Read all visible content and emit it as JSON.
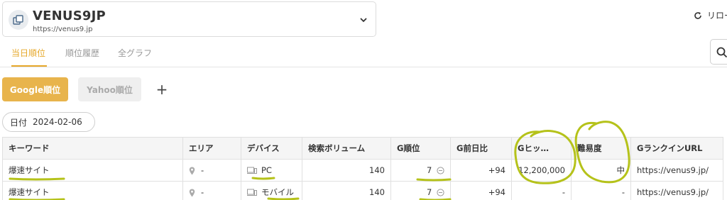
{
  "site": {
    "name": "VENUS9JP",
    "url": "https://venus9.jp"
  },
  "header": {
    "reload_label": "リロー"
  },
  "tabs": [
    {
      "label": "当日順位",
      "active": true
    },
    {
      "label": "順位履歴",
      "active": false
    },
    {
      "label": "全グラフ",
      "active": false
    }
  ],
  "engines": {
    "google_label": "Google順位",
    "yahoo_label": "Yahoo順位",
    "add_label": "+"
  },
  "date": {
    "label": "日付",
    "value": "2024-02-06"
  },
  "table": {
    "headers": [
      "キーワード",
      "エリア",
      "デバイス",
      "検索ボリューム",
      "G順位",
      "G前日比",
      "Gヒッ…",
      "難易度",
      "GランクインURL"
    ],
    "rows": [
      {
        "keyword": "爆速サイト",
        "area": "-",
        "device": "PC",
        "volume": "140",
        "rank": "7",
        "change": "+94",
        "hits": "12,200,000",
        "difficulty": "中",
        "url": "https://venus9.jp/"
      },
      {
        "keyword": "爆速サイト",
        "area": "-",
        "device": "モバイル",
        "volume": "140",
        "rank": "7",
        "change": "+94",
        "hits": "-",
        "difficulty": "-",
        "url": "https://venus9.jp/"
      }
    ]
  },
  "colors": {
    "accent": "#e6a82b",
    "google_button": "#e8b44c",
    "link": "#2a8fd0",
    "highlighter": "#b5c21a"
  }
}
